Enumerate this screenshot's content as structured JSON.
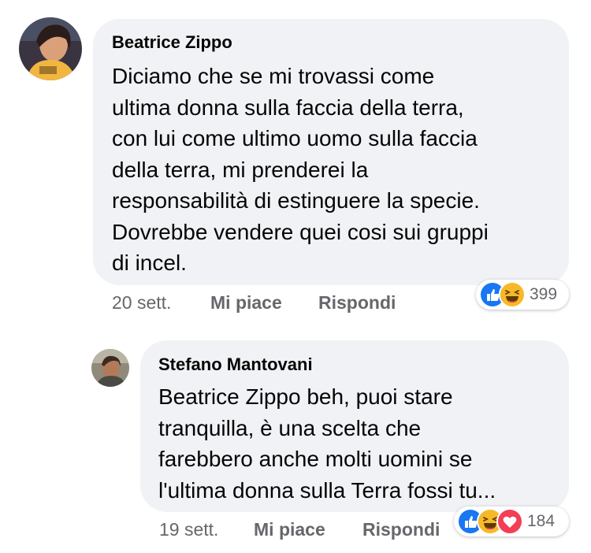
{
  "comments": [
    {
      "author": "Beatrice Zippo",
      "text": "Diciamo che se mi trovassi come\nultima donna sulla faccia della terra,\ncon lui come ultimo uomo sulla faccia\ndella terra, mi prenderei la\nresponsabilità di estinguere la specie.\nDovrebbe vendere quei cosi sui gruppi\ndi incel.",
      "time": "20 sett.",
      "like_label": "Mi piace",
      "reply_label": "Rispondi",
      "reactions": [
        "like-icon",
        "haha-icon"
      ],
      "reaction_count": "399"
    },
    {
      "author": "Stefano Mantovani",
      "text": "Beatrice Zippo beh, puoi stare\ntranquilla, è una scelta che\nfarebbero anche molti uomini se\nl'ultima donna sulla Terra fossi tu...",
      "time": "19 sett.",
      "like_label": "Mi piace",
      "reply_label": "Rispondi",
      "reactions": [
        "like-icon",
        "haha-icon",
        "love-icon"
      ],
      "reaction_count": "184"
    }
  ],
  "colors": {
    "bubble": "#f0f2f5",
    "meta_text": "#65676b",
    "like_blue": "#1877f2",
    "haha_yellow": "#f7b928",
    "love_red": "#f33e58"
  }
}
